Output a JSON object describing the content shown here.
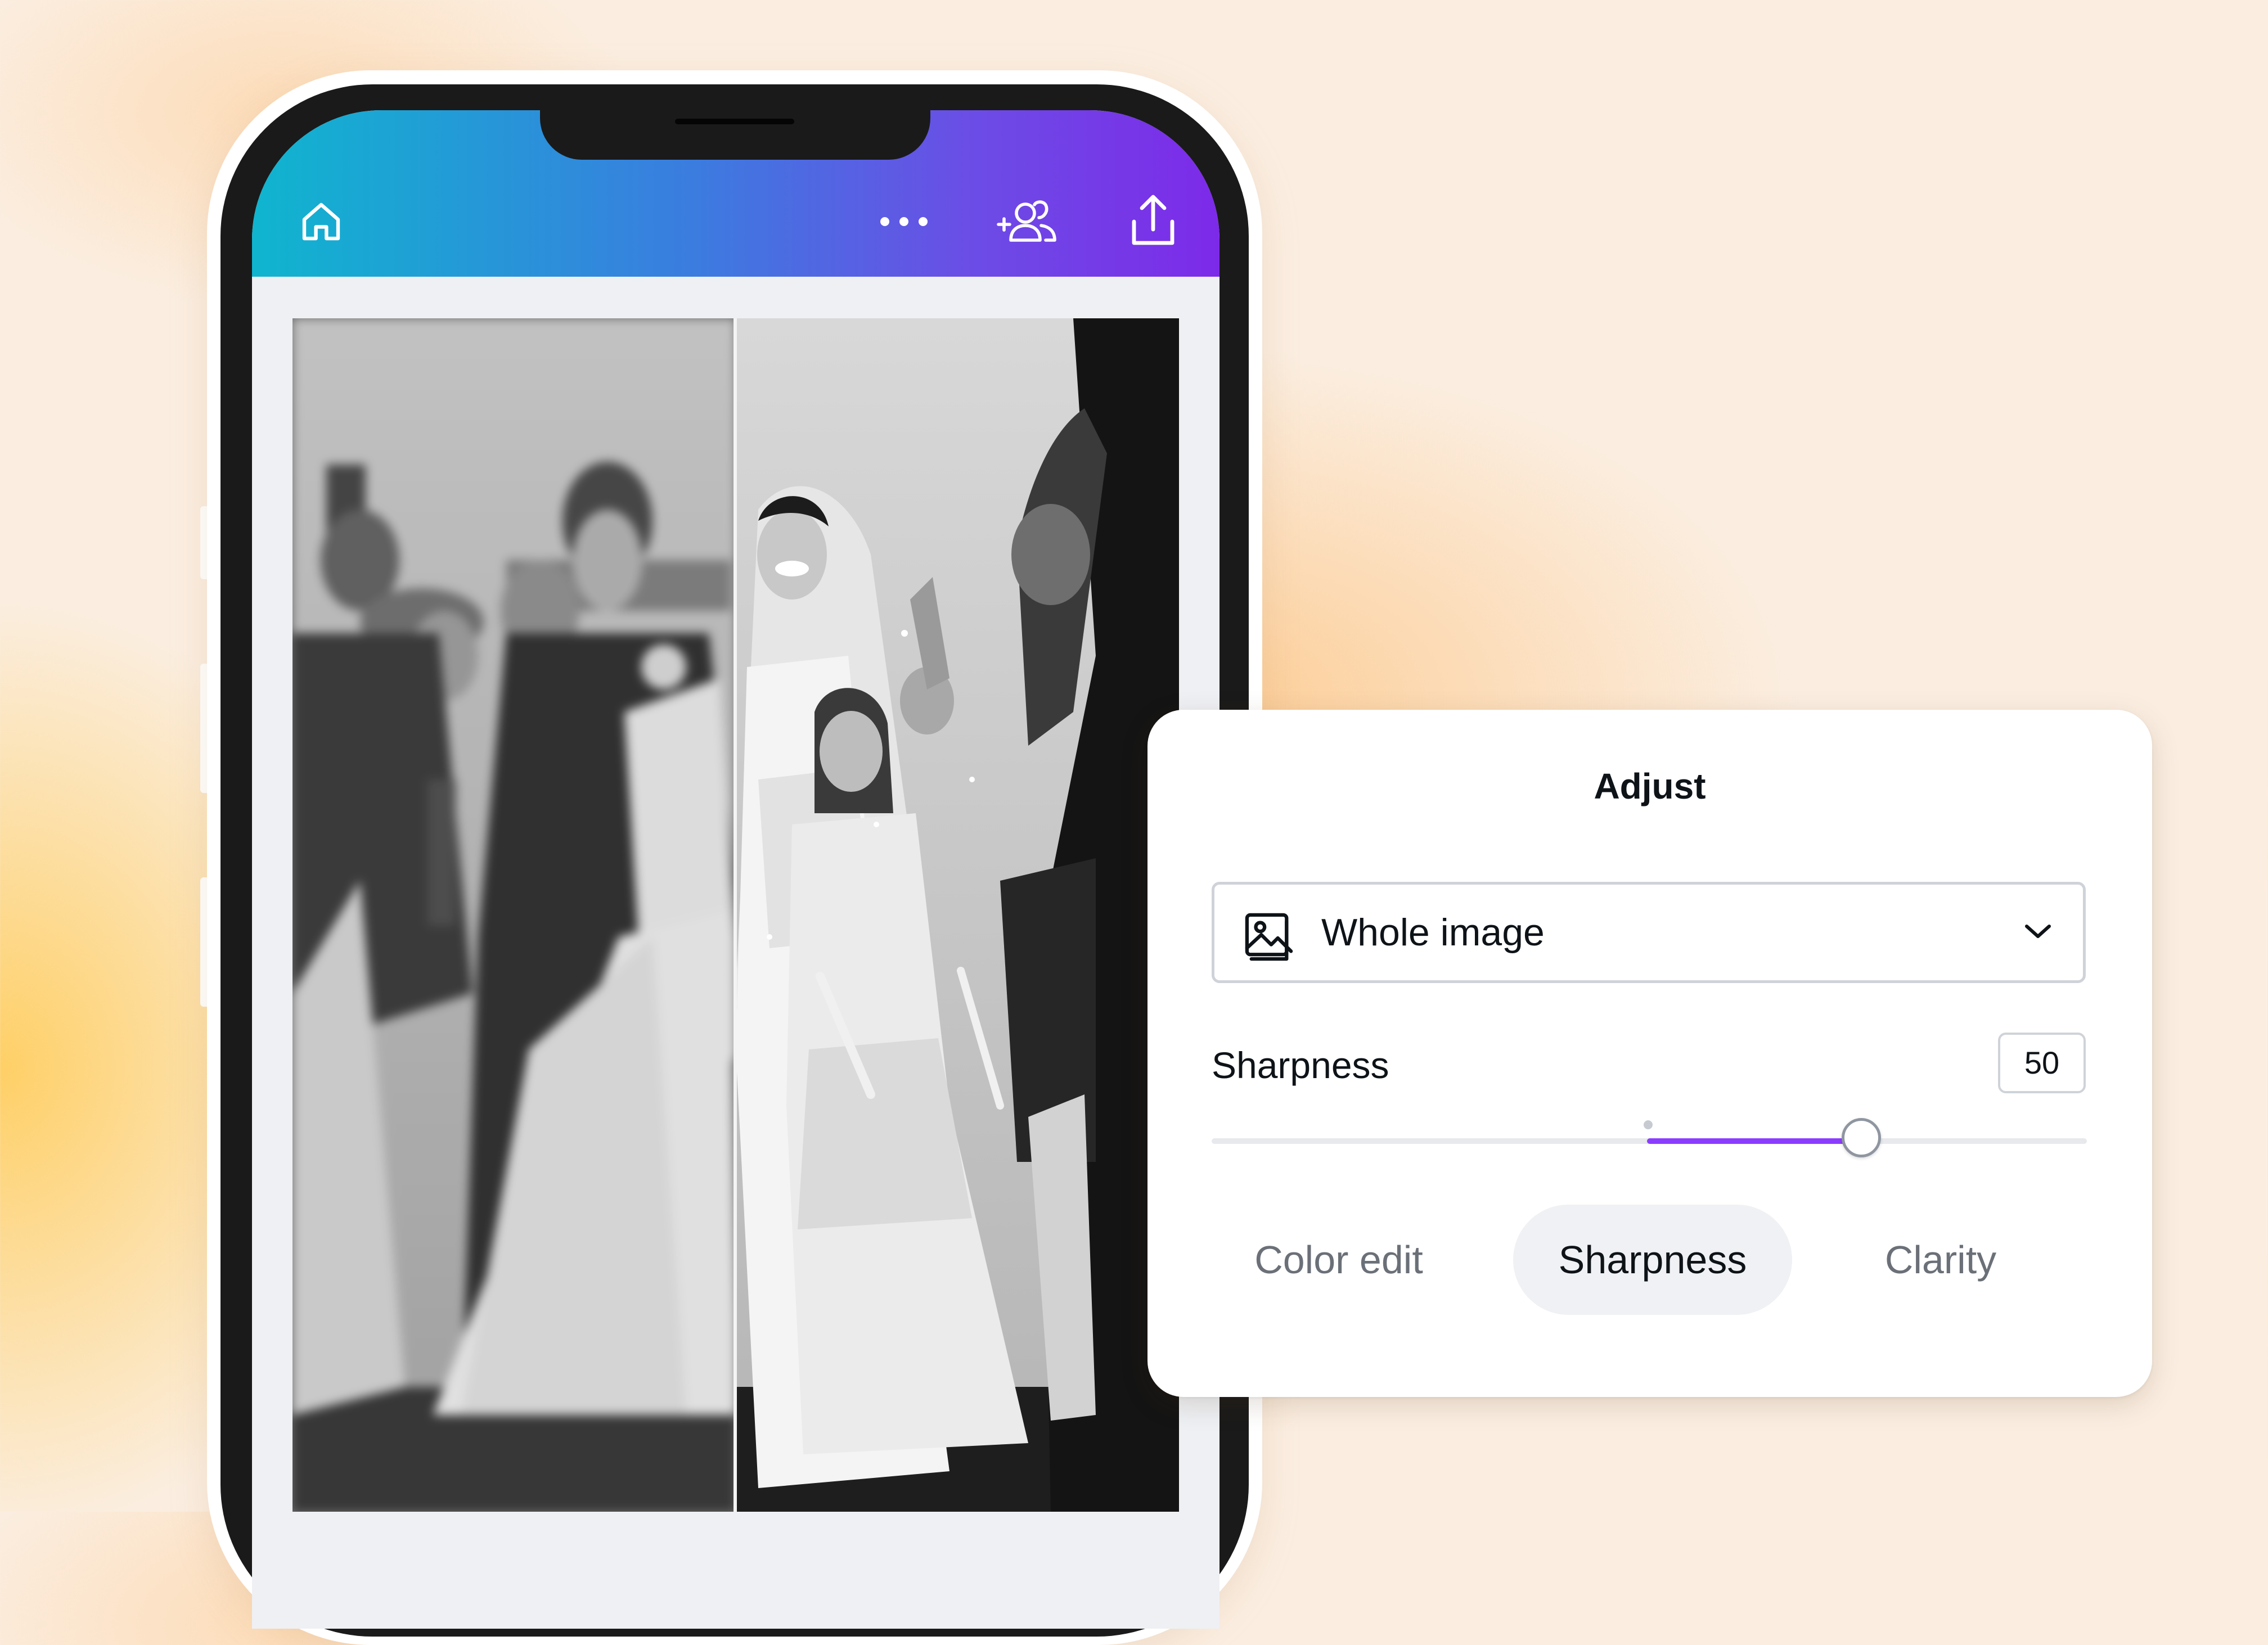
{
  "app": {
    "topbar": {
      "icons": [
        "home-icon",
        "more-icon",
        "add-people-icon",
        "share-icon"
      ]
    }
  },
  "adjust_panel": {
    "title": "Adjust",
    "selection": {
      "label": "Whole image",
      "icon": "image-icon"
    },
    "slider": {
      "label": "Sharpness",
      "value": "50",
      "accent_color": "#8b3dff"
    },
    "tabs": [
      {
        "label": "Color edit",
        "active": false
      },
      {
        "label": "Sharpness",
        "active": true
      },
      {
        "label": "Clarity",
        "active": false
      }
    ]
  },
  "colors": {
    "topbar_gradient": [
      "#0fb5cf",
      "#7d2ae8"
    ],
    "panel_bg": "#ffffff"
  }
}
